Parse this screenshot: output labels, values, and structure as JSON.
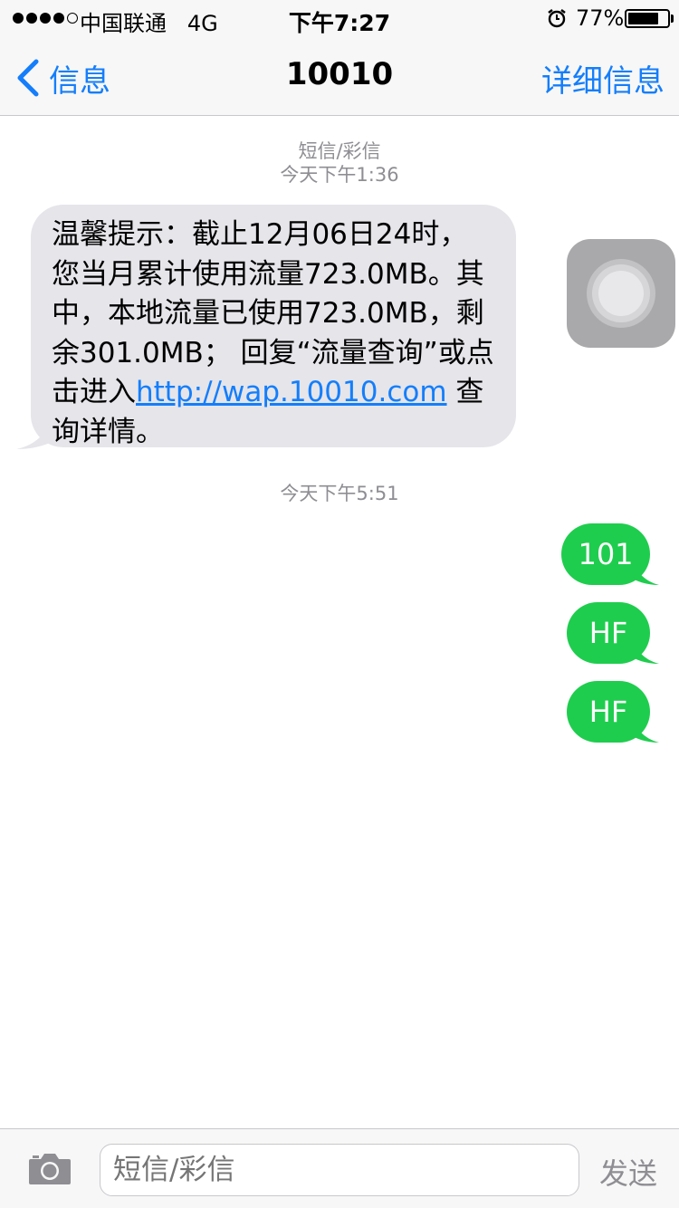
{
  "status_bar": {
    "carrier": "中国联通",
    "network": "4G",
    "time": "下午7:27",
    "battery_percent": "77%",
    "battery_level": 0.77,
    "signal_bars": 4,
    "signal_total": 5
  },
  "nav": {
    "back_label": "信息",
    "title": "10010",
    "details_label": "详细信息"
  },
  "conversation": {
    "header_type": "短信/彩信",
    "header_time": "今天下午1:36",
    "incoming_message": {
      "text": "温馨提示：截止12月06日24时，您当月累计使用流量723.0MB。其中，本地流量已使用723.0MB，剩余301.0MB；  回复“流量查询”或点击进入",
      "link": "http://wap.10010.com",
      "suffix": " 查询详情。"
    },
    "second_time": "今天下午5:51",
    "outgoing_messages": [
      "101",
      "HF",
      "HF"
    ]
  },
  "input_bar": {
    "placeholder": "短信/彩信",
    "send_label": "发送"
  },
  "colors": {
    "accent": "#147efb",
    "outgoing_bubble": "#1fcd4e",
    "incoming_bubble": "#e5e5ea",
    "meta_text": "#8e8e93"
  }
}
